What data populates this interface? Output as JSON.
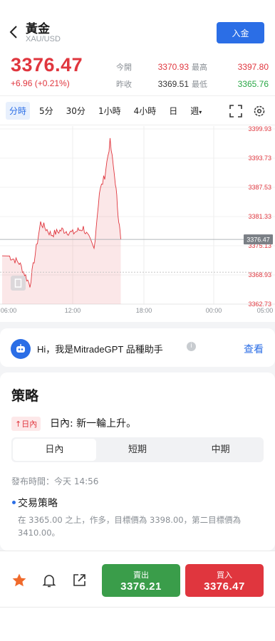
{
  "header": {
    "title": "黃金",
    "subtitle": "XAU/USD",
    "deposit_label": "入金"
  },
  "quote": {
    "price": "3376.47",
    "change": "+6.96 (+0.21%)",
    "open_label": "今開",
    "open_value": "3370.93",
    "high_label": "最高",
    "high_value": "3397.80",
    "prev_close_label": "昨收",
    "prev_close_value": "3369.51",
    "low_label": "最低",
    "low_value": "3365.76"
  },
  "timeframes": [
    "分時",
    "5分",
    "30分",
    "1小時",
    "4小時",
    "日",
    "週"
  ],
  "timeframe_selected": "分時",
  "chart_data": {
    "type": "line",
    "x_ticks": [
      "06:00",
      "12:00",
      "18:00",
      "00:00",
      "05:00"
    ],
    "y_ticks": [
      "3399.93",
      "3393.73",
      "3387.53",
      "3381.33",
      "3375.13",
      "3368.93",
      "3362.73"
    ],
    "current_price_label": "3376.47",
    "ylim": [
      3362.73,
      3399.93
    ],
    "series": [
      {
        "x": [
          "06:00",
          "07:00",
          "08:00",
          "09:00",
          "10:00",
          "11:00",
          "12:00",
          "13:00",
          "14:00",
          "14:30",
          "15:00",
          "15:30",
          "16:00",
          "16:15",
          "16:30"
        ],
        "values": [
          3373.0,
          3371.5,
          3366.8,
          3380.0,
          3377.5,
          3378.5,
          3377.8,
          3378.9,
          3374.5,
          3386.4,
          3390.0,
          3397.2,
          3388.6,
          3382.0,
          3376.47
        ]
      }
    ]
  },
  "gpt": {
    "text": "Hi，我是MitradeGPT 品種助手",
    "view_label": "查看"
  },
  "strategy": {
    "title": "策略",
    "badge": "日內",
    "headline": "日內: 新一輪上升。",
    "segments": [
      "日內",
      "短期",
      "中期"
    ],
    "segment_selected": "日內",
    "published": "發布時間：今天 14:56",
    "trade_title": "交易策略",
    "trade_desc": "在 3365.00 之上，作多，目標價為 3398.00，第二目標價為 3410.00。"
  },
  "bottom": {
    "sell_label": "賣出",
    "sell_price": "3376.21",
    "buy_label": "買入",
    "buy_price": "3376.47"
  },
  "colors": {
    "up": "#e0363e",
    "down": "#28a745",
    "accent": "#2b6ee6"
  },
  "icons": [
    "back-arrow-icon",
    "fullscreen-icon",
    "settings-icon",
    "star-icon",
    "bell-icon",
    "share-icon",
    "robot-icon",
    "info-icon"
  ]
}
